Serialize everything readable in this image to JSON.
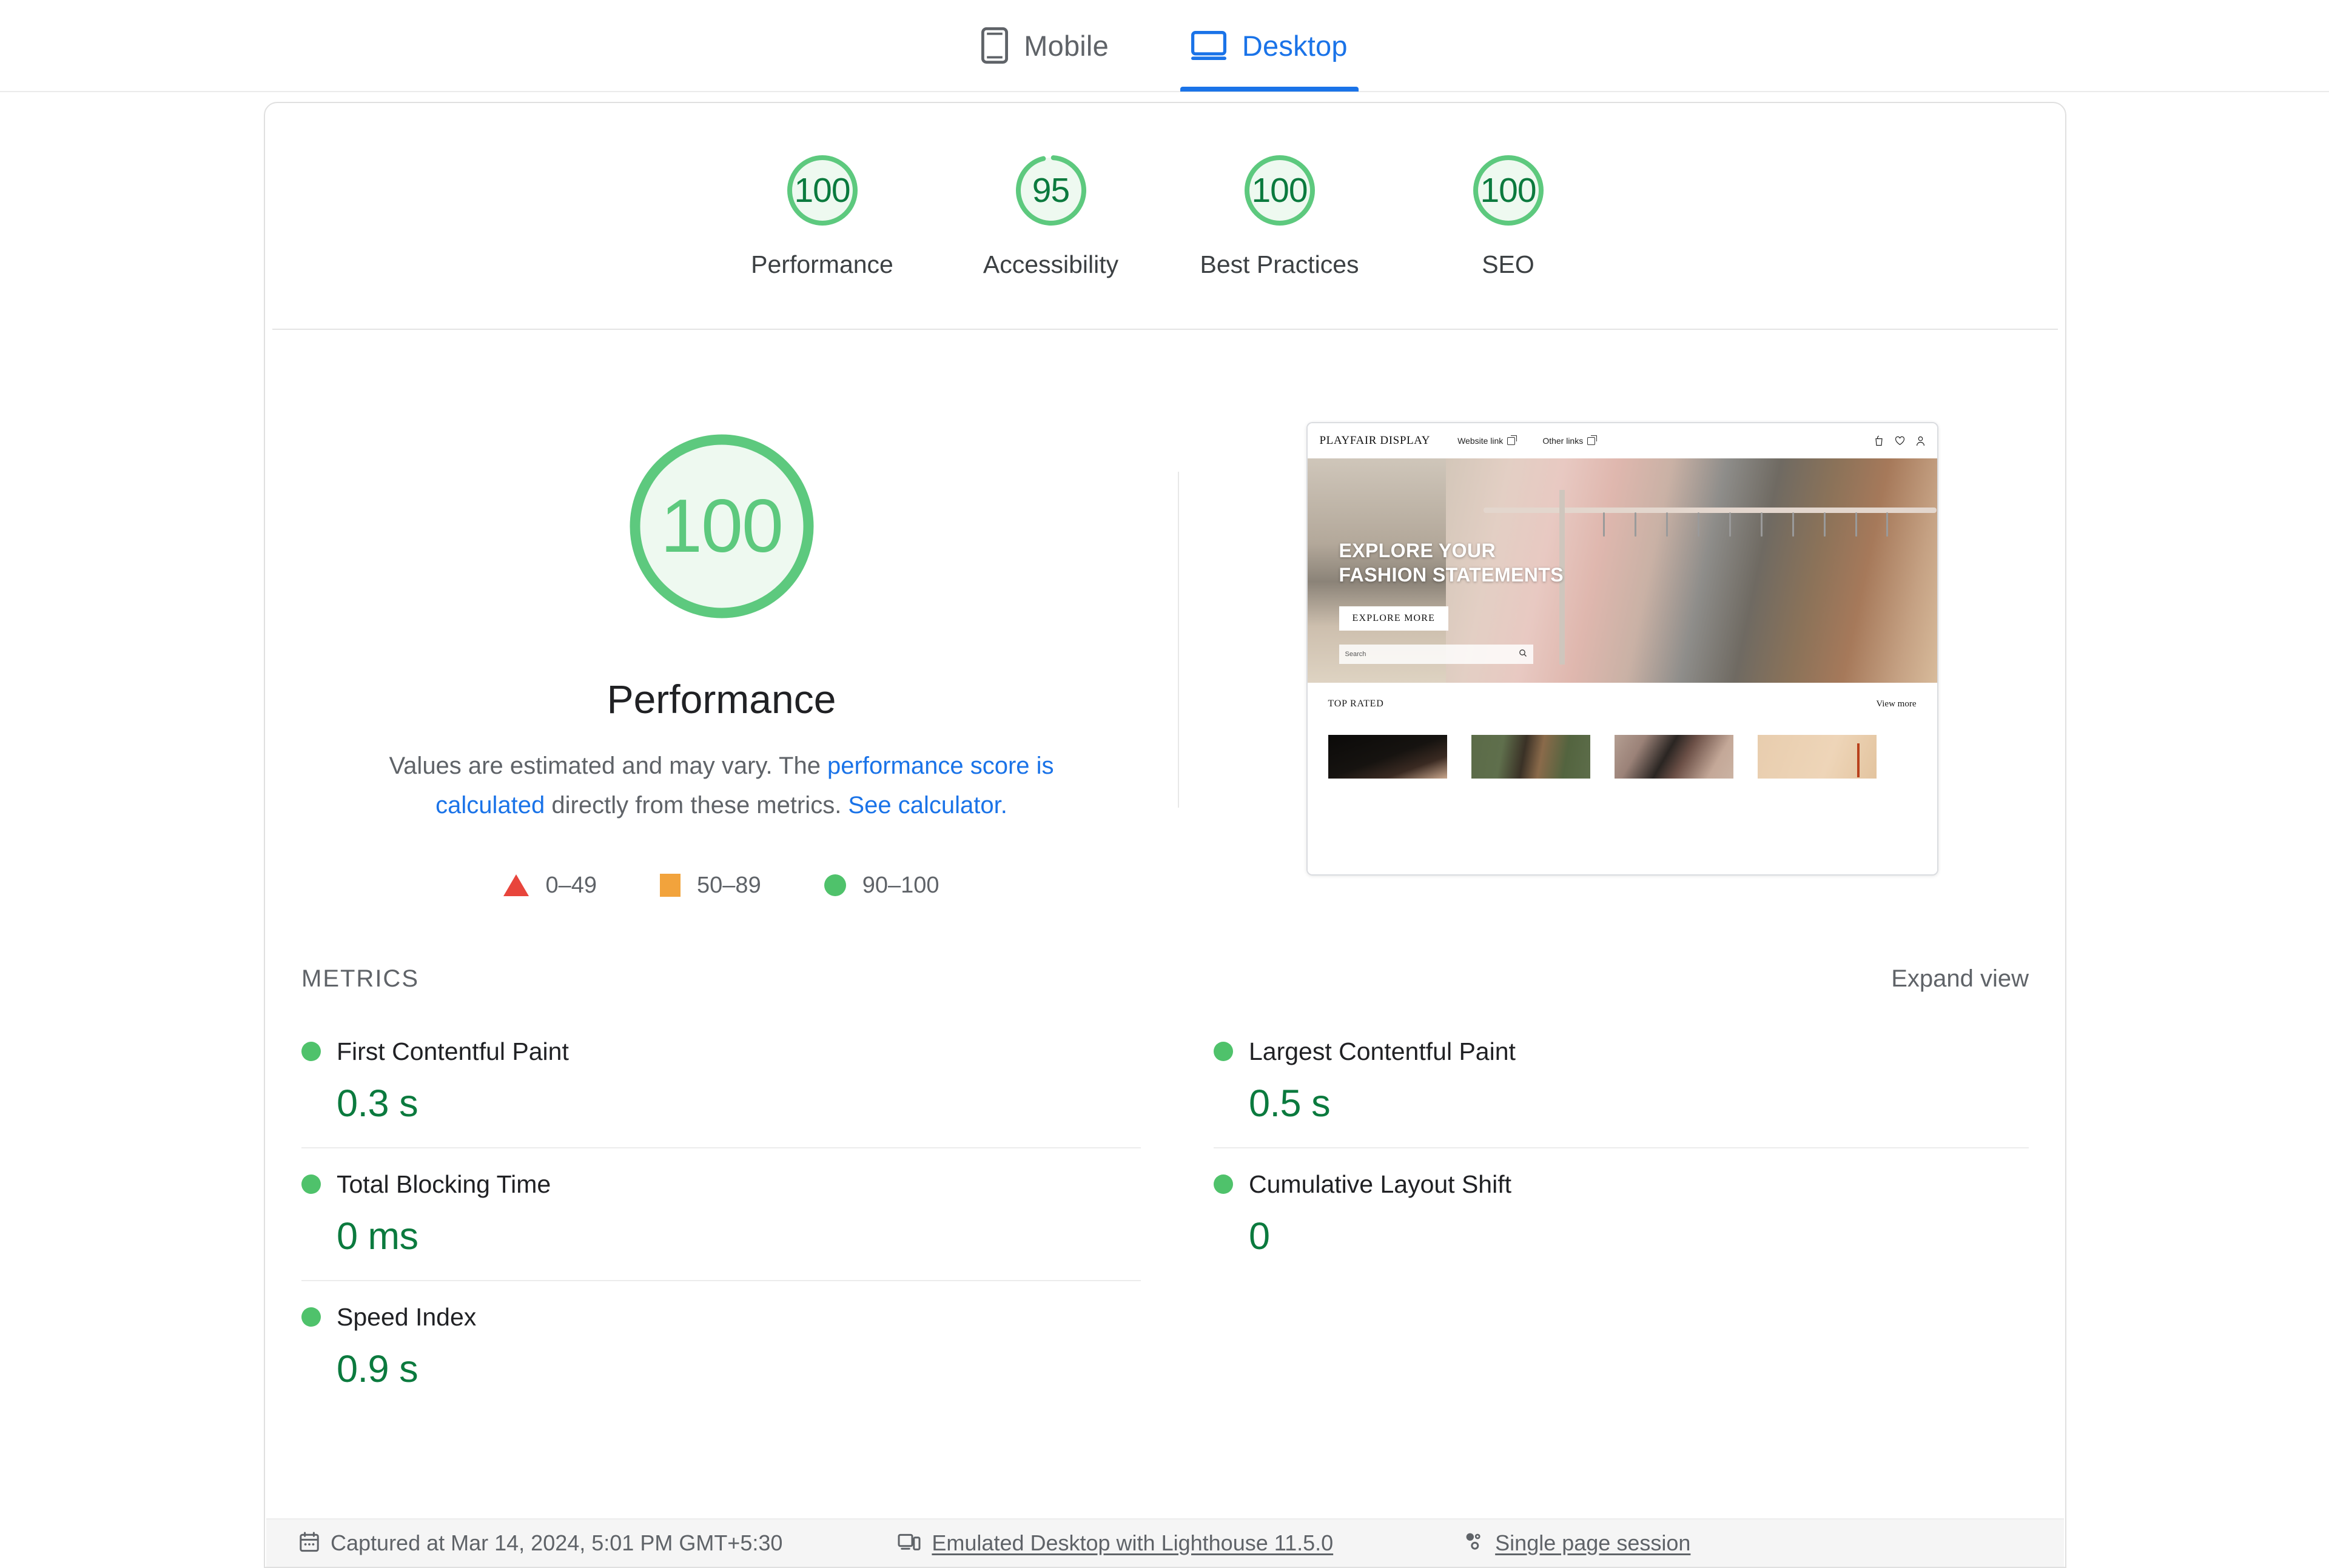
{
  "tabs": [
    {
      "label": "Mobile",
      "icon": "mobile-icon",
      "active": false
    },
    {
      "label": "Desktop",
      "icon": "desktop-icon",
      "active": true
    }
  ],
  "colors": {
    "accent": "#1a73e8",
    "pass_green": "#4fc26b",
    "pass_green_text": "#0b7a3e",
    "gauge_fill": "#eef9f0",
    "average_orange": "#f2a33c",
    "fail_red": "#e8453c",
    "muted_text": "#5f6368"
  },
  "summary_gauges": [
    {
      "score": "100",
      "category": "Performance"
    },
    {
      "score": "95",
      "category": "Accessibility"
    },
    {
      "score": "100",
      "category": "Best Practices"
    },
    {
      "score": "100",
      "category": "SEO"
    }
  ],
  "hero": {
    "score": "100",
    "title": "Performance",
    "desc_part1": "Values are estimated and may vary. The ",
    "desc_link1": "performance score is calculated",
    "desc_part2": " directly from these metrics. ",
    "desc_link2": "See calculator.",
    "legend": [
      {
        "shape": "triangle",
        "range": "0–49"
      },
      {
        "shape": "square",
        "range": "50–89"
      },
      {
        "shape": "circle",
        "range": "90–100"
      }
    ]
  },
  "thumbnail": {
    "brand": "PLAYFAIR DISPLAY",
    "nav_links": [
      "Website link",
      "Other links"
    ],
    "headline_line1": "EXPLORE YOUR",
    "headline_line2": "FASHION STATEMENTS",
    "cta": "EXPLORE MORE",
    "search_placeholder": "Search",
    "section_title": "TOP RATED",
    "view_more": "View more"
  },
  "metrics_section": {
    "title": "METRICS",
    "expand_label": "Expand view",
    "left_column": [
      {
        "name": "First Contentful Paint",
        "value": "0.3 s",
        "status": "pass"
      },
      {
        "name": "Total Blocking Time",
        "value": "0 ms",
        "status": "pass"
      },
      {
        "name": "Speed Index",
        "value": "0.9 s",
        "status": "pass"
      }
    ],
    "right_column": [
      {
        "name": "Largest Contentful Paint",
        "value": "0.5 s",
        "status": "pass"
      },
      {
        "name": "Cumulative Layout Shift",
        "value": "0",
        "status": "pass"
      }
    ]
  },
  "footer": {
    "captured": "Captured at Mar 14, 2024, 5:01 PM GMT+5:30",
    "environment": "Emulated Desktop with Lighthouse 11.5.0",
    "session": "Single page session"
  }
}
